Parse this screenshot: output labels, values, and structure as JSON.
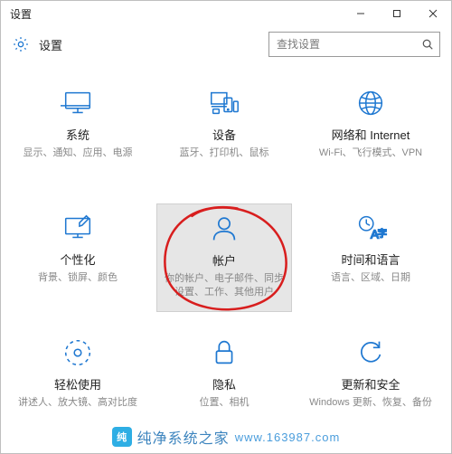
{
  "window": {
    "app_caption": "设置",
    "controls": {
      "min": "—",
      "max": "□",
      "close": "×"
    }
  },
  "header": {
    "title": "设置"
  },
  "search": {
    "placeholder": "查找设置"
  },
  "tiles": [
    {
      "id": "system",
      "icon": "monitor-icon",
      "title": "系统",
      "desc": "显示、通知、应用、电源"
    },
    {
      "id": "devices",
      "icon": "devices-icon",
      "title": "设备",
      "desc": "蓝牙、打印机、鼠标"
    },
    {
      "id": "network",
      "icon": "network-icon",
      "title": "网络和 Internet",
      "desc": "Wi-Fi、飞行模式、VPN"
    },
    {
      "id": "personalize",
      "icon": "personal-icon",
      "title": "个性化",
      "desc": "背景、锁屏、颜色"
    },
    {
      "id": "accounts",
      "icon": "account-icon",
      "title": "帐户",
      "desc": "你的帐户、电子邮件、同步设置、工作、其他用户"
    },
    {
      "id": "time-language",
      "icon": "timelang-icon",
      "title": "时间和语言",
      "desc": "语言、区域、日期"
    },
    {
      "id": "ease-of-access",
      "icon": "ease-icon",
      "title": "轻松使用",
      "desc": "讲述人、放大镜、高对比度"
    },
    {
      "id": "privacy",
      "icon": "privacy-icon",
      "title": "隐私",
      "desc": "位置、相机"
    },
    {
      "id": "update",
      "icon": "update-icon",
      "title": "更新和安全",
      "desc": "Windows 更新、恢复、备份"
    }
  ],
  "selected_tile_index": 4,
  "annotation": {
    "circled_tile_index": 4,
    "stroke_color": "#d81e1e"
  },
  "watermark": {
    "logo_text": "纯",
    "site": "纯净系统之家",
    "url_text": "www.163987.com"
  },
  "colors": {
    "accent": "#1f78d1",
    "muted_text": "#888888"
  }
}
